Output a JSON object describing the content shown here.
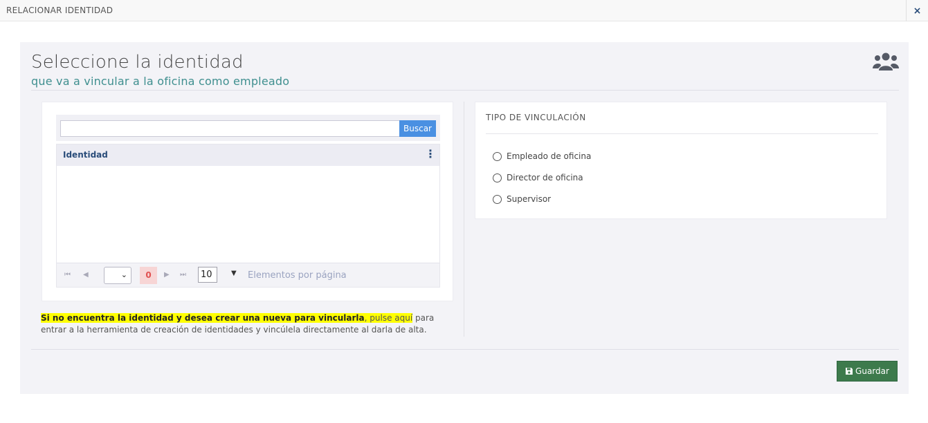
{
  "window": {
    "title": "RELACIONAR IDENTIDAD",
    "close_label": "×"
  },
  "header": {
    "title": "Seleccione la identidad",
    "subtitle": "que va a vincular a la oficina como empleado",
    "icon": "users-icon"
  },
  "search": {
    "value": "",
    "placeholder": "",
    "button_label": "Buscar"
  },
  "grid": {
    "column": "Identidad",
    "menu_icon": "kebab-icon",
    "rows": []
  },
  "pager": {
    "page_count": "0",
    "page_size": "10",
    "page_size_label": "Elementos por página"
  },
  "vinculacion": {
    "title": "TIPO DE VINCULACIÓN",
    "options": [
      {
        "label": "Empleado de oficina",
        "selected": false
      },
      {
        "label": "Director de oficina",
        "selected": false
      },
      {
        "label": "Supervisor",
        "selected": false
      }
    ]
  },
  "note": {
    "bold_part": "Si no encuentra la identidad y desea crear una nueva para vincularla",
    "comma": ", ",
    "link_part": "pulse aquí",
    "rest": " para entrar a la herramienta de creación de identidades y vincúlela directamente al darla de alta."
  },
  "footer": {
    "save_label": "Guardar",
    "save_icon": "save-icon"
  },
  "colors": {
    "accent_blue": "#4a90e2",
    "save_green": "#3d7a4c",
    "subtitle_teal": "#3f8f8f",
    "highlight": "#ffff00"
  }
}
